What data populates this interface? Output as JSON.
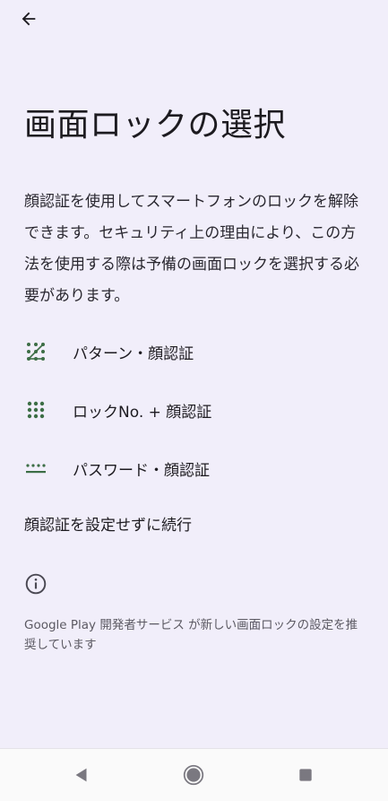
{
  "header": {
    "back_icon": "arrow-back-icon"
  },
  "title": "画面ロックの選択",
  "description": "顔認証を使用してスマートフォンのロックを解除できます。セキュリティ上の理由により、この方法を使用する際は予備の画面ロックを選択する必要があります。",
  "options": [
    {
      "icon": "pattern-icon",
      "label": "パターン・顔認証"
    },
    {
      "icon": "pin-icon",
      "label": "ロックNo. + 顔認証"
    },
    {
      "icon": "password-icon",
      "label": "パスワード・顔認証"
    }
  ],
  "skip_label": "顔認証を設定せずに続行",
  "info": {
    "icon": "info-icon",
    "text": "Google Play 開発者サービス が新しい画面ロックの設定を推奨しています"
  },
  "colors": {
    "background": "#f1eefa",
    "icon_green": "#3d6e46",
    "text": "#1d1b20"
  },
  "nav": {
    "back": "nav-back-icon",
    "home": "nav-home-icon",
    "recents": "nav-recents-icon"
  }
}
